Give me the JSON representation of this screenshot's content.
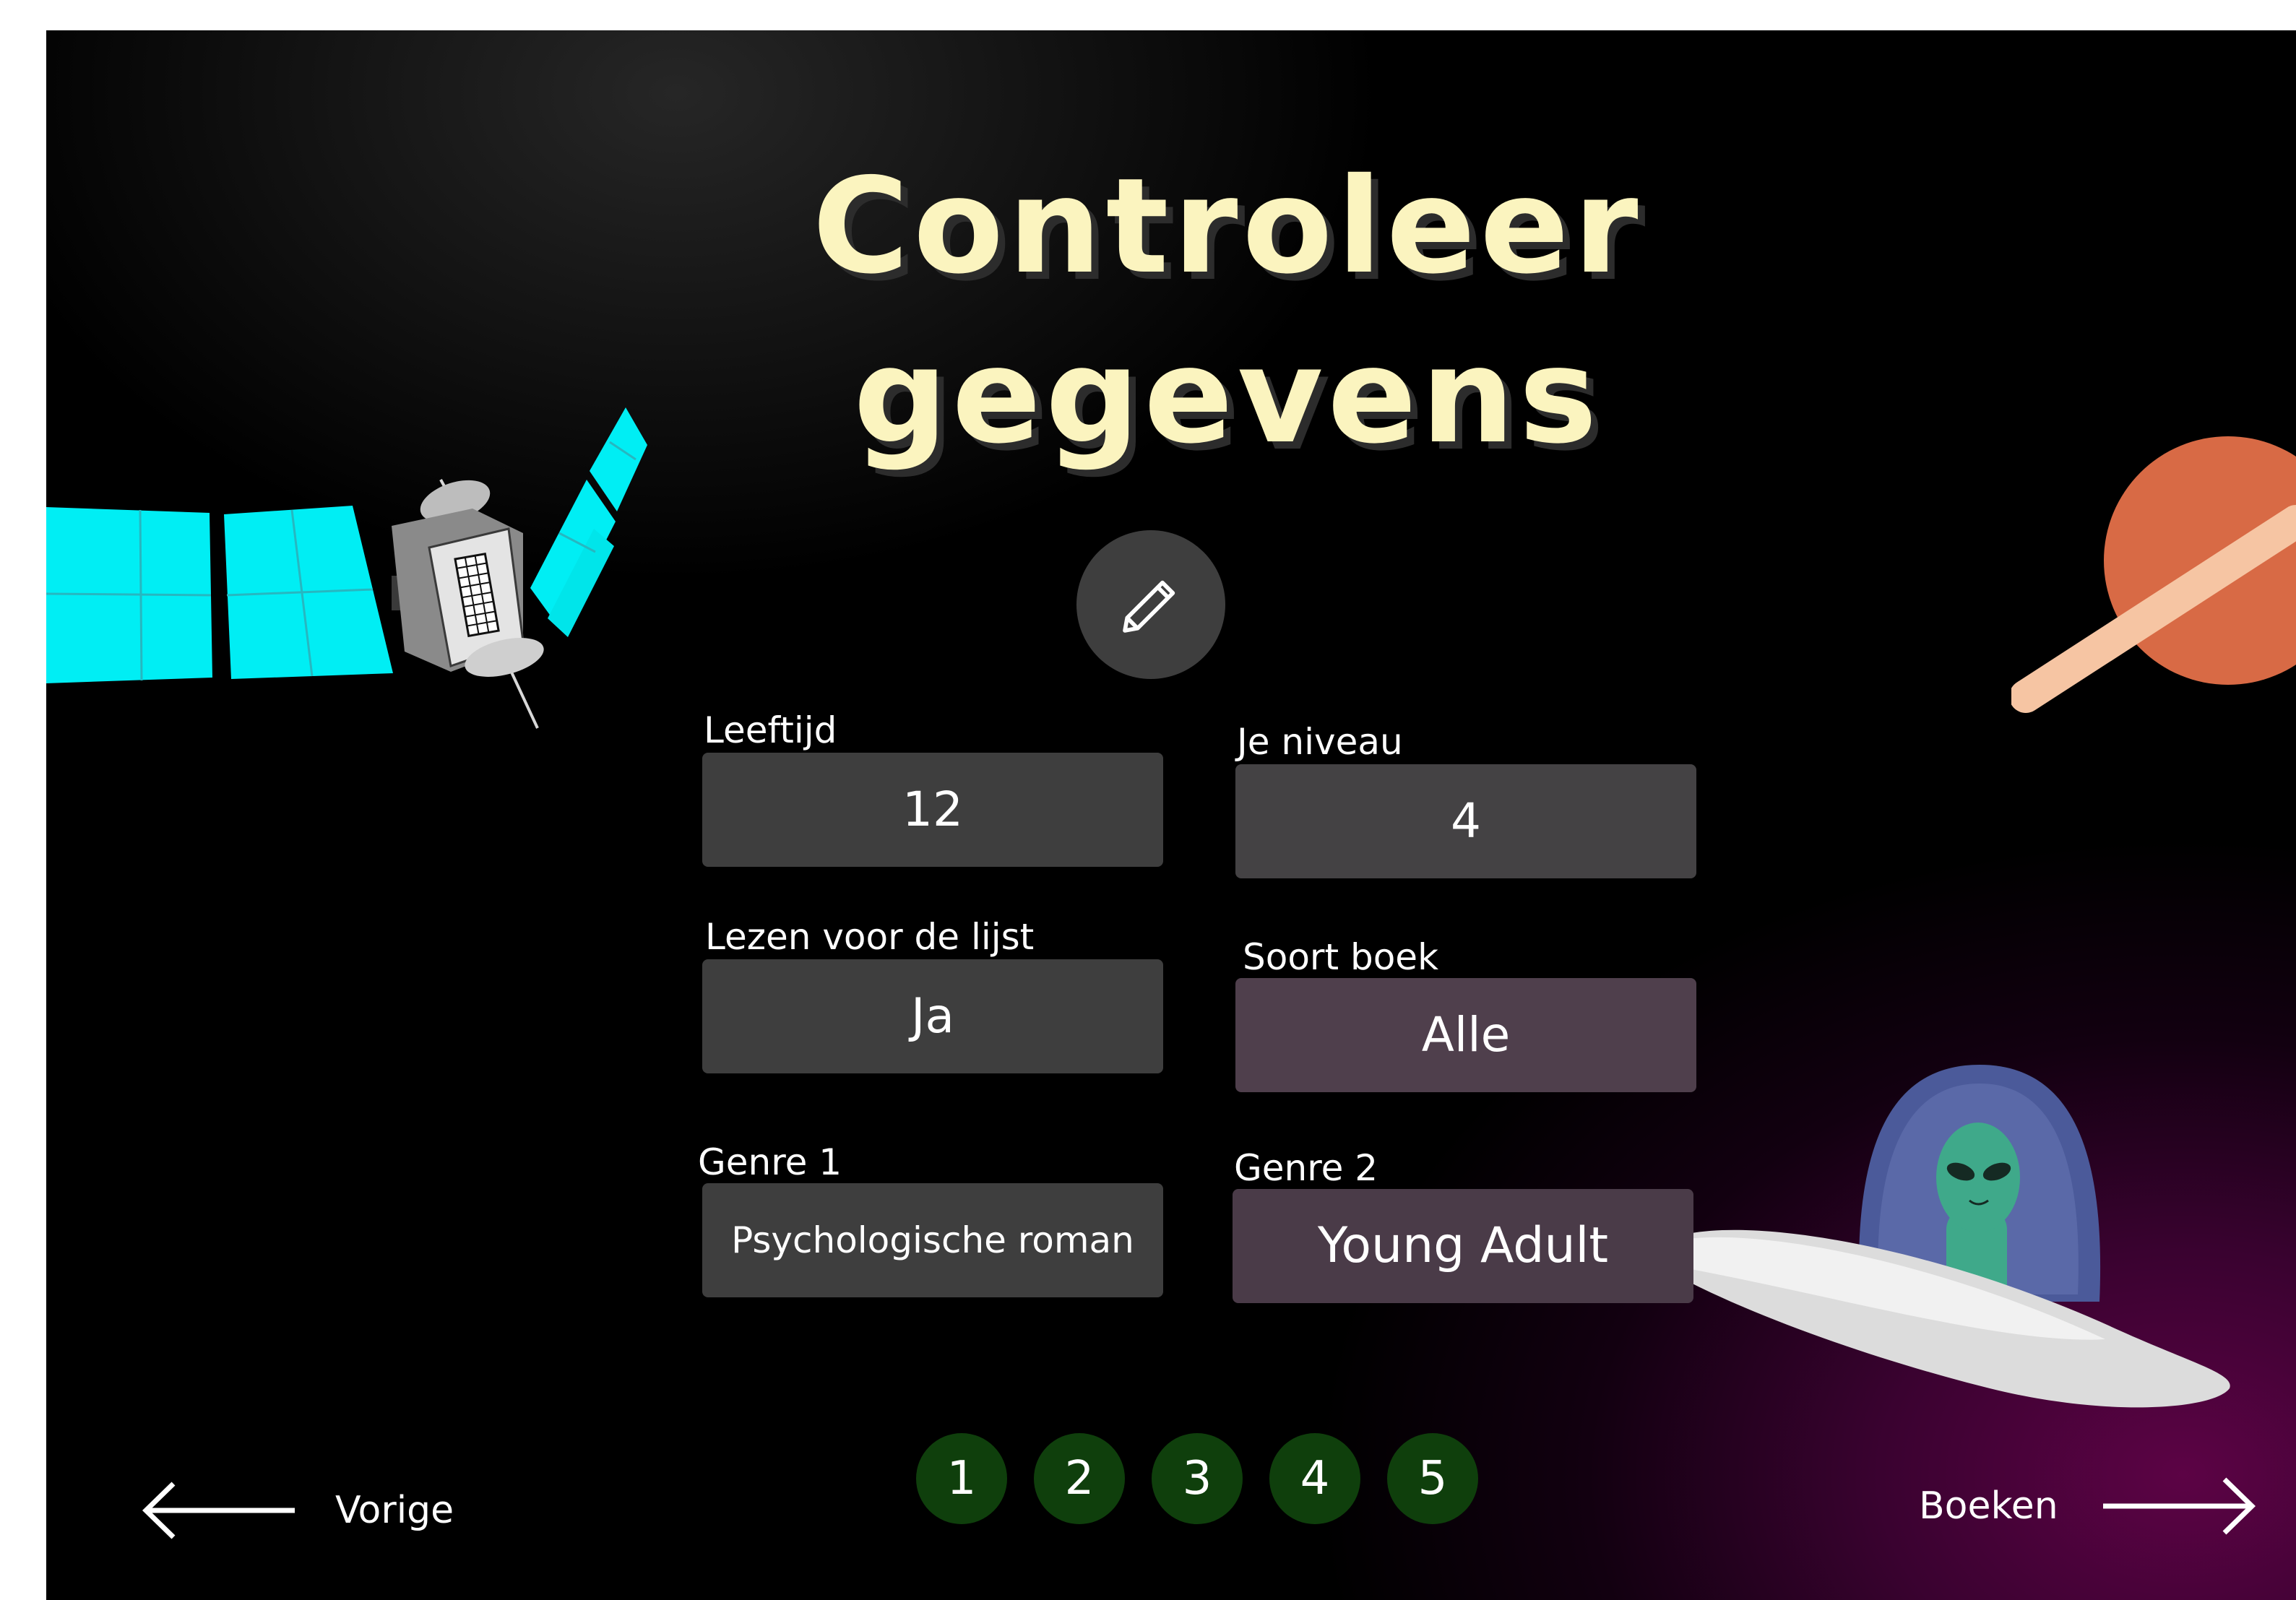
{
  "page": {
    "title_line1": "Controleer",
    "title_line2": "gegevens"
  },
  "fields": {
    "age": {
      "label": "Leeftijd",
      "value": "12"
    },
    "level": {
      "label": "Je niveau",
      "value": "4"
    },
    "read_for_list": {
      "label": "Lezen voor de lijst",
      "value": "Ja"
    },
    "book_type": {
      "label": "Soort boek",
      "value": "Alle"
    },
    "genre1": {
      "label": "Genre 1",
      "value": "Psychologische roman"
    },
    "genre2": {
      "label": "Genre 2",
      "value": "Young Adult"
    }
  },
  "navigation": {
    "previous_label": "Vorige",
    "next_label": "Boeken"
  },
  "steps": [
    "1",
    "2",
    "3",
    "4",
    "5"
  ],
  "icons": {
    "edit": "pencil-icon",
    "previous": "arrow-left-icon",
    "next": "arrow-right-icon"
  },
  "colors": {
    "title": "#fbf4bf",
    "field_background": "#3e3e3e",
    "step_background": "#0f3f0c",
    "edit_button": "#3e3e3e",
    "solar_panel": "#00eef4",
    "planet": "#d86a45",
    "planet_ring": "#f6c5a3",
    "ufo_dome": "#4b5a9a",
    "alien": "#3fa98a"
  }
}
